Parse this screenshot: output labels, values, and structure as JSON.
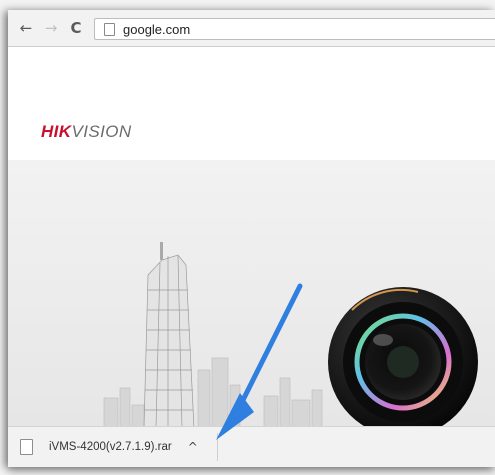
{
  "browser": {
    "back_glyph": "←",
    "forward_glyph": "→",
    "reload_glyph": "C",
    "url": "google.com"
  },
  "page": {
    "logo_hik": "HIK",
    "logo_vision": "VISION",
    "logo_colors": {
      "hik": "#c8102e",
      "vision": "#6b6b6b"
    }
  },
  "download_bar": {
    "filename": "iVMS-4200(v2.7.1.9).rar",
    "menu_glyph": "^"
  },
  "annotation": {
    "arrow_color": "#2f7fe0"
  }
}
